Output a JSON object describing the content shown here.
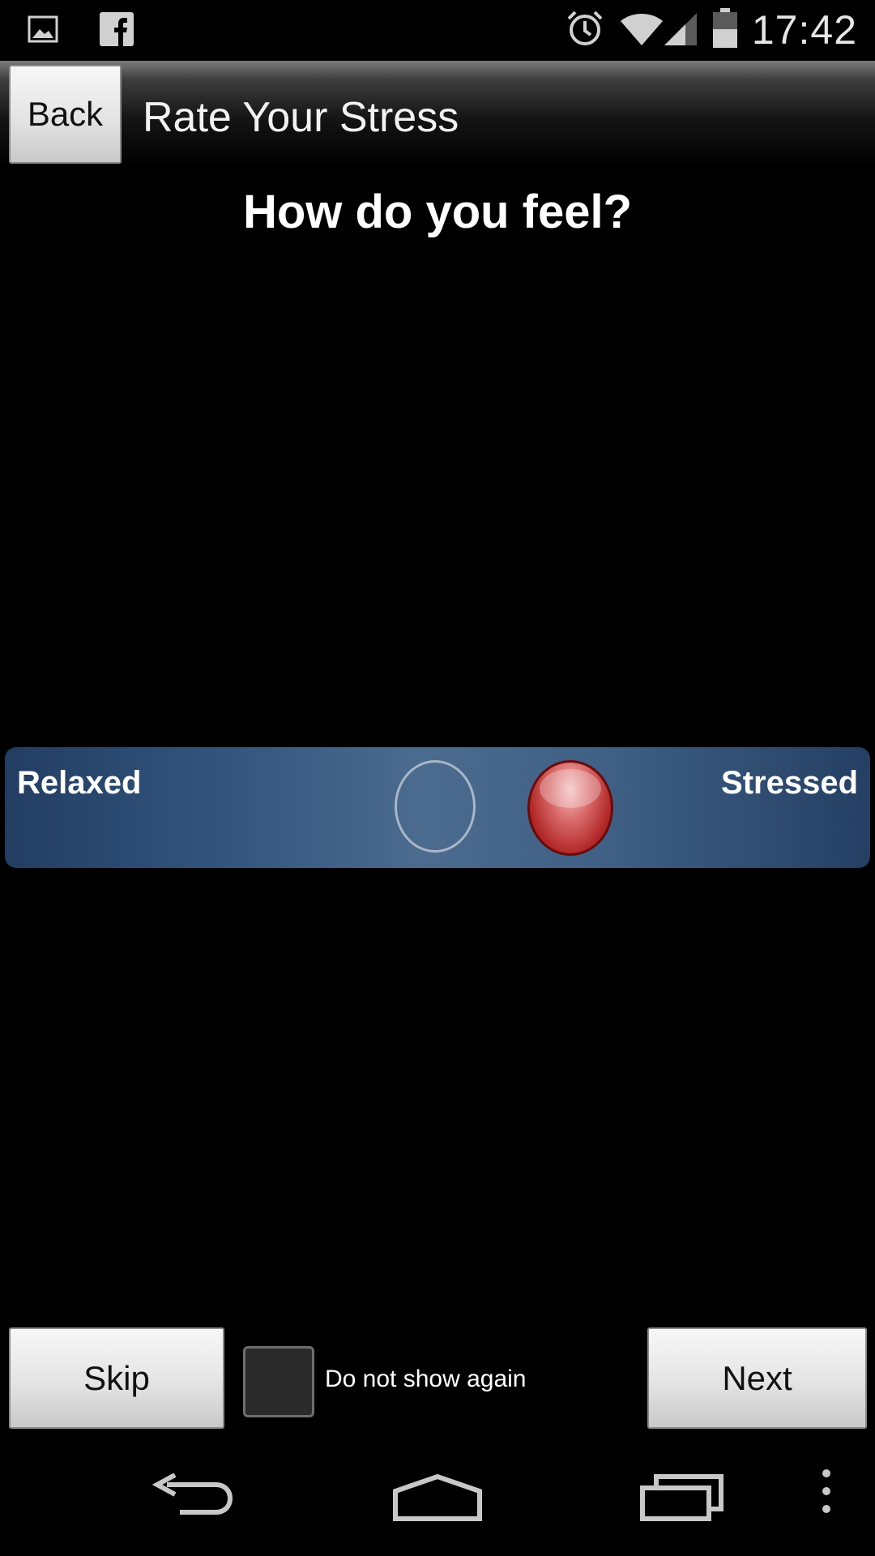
{
  "status_bar": {
    "time": "17:42",
    "icons": [
      "gallery-icon",
      "facebook-icon",
      "alarm-icon",
      "wifi-icon",
      "signal-icon",
      "battery-icon"
    ]
  },
  "title_bar": {
    "back_label": "Back",
    "title": "Rate Your Stress"
  },
  "main": {
    "question": "How do you feel?",
    "slider": {
      "left_label": "Relaxed",
      "right_label": "Stressed"
    }
  },
  "footer": {
    "skip_label": "Skip",
    "do_not_show_label": "Do not show again",
    "do_not_show_checked": false,
    "next_label": "Next"
  },
  "nav_bar": {
    "icons": [
      "back-nav-icon",
      "home-nav-icon",
      "recents-nav-icon",
      "overflow-menu-icon"
    ]
  },
  "colors": {
    "slider_dark": "#223d62",
    "slider_mid": "#4b6b8f",
    "knob_red": "#b32a2a",
    "background": "#000000"
  }
}
